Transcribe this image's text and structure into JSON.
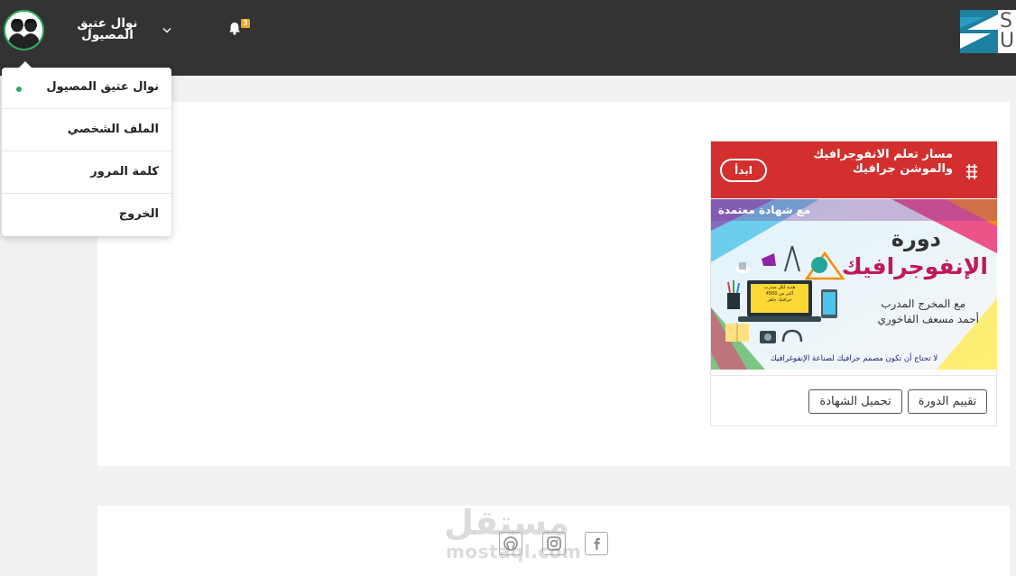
{
  "header": {
    "user_name": "نوال عتيق المصيول",
    "notification_count": "3",
    "brand_letters": [
      "S",
      "U"
    ]
  },
  "user_menu": {
    "items": [
      {
        "label": "نوال عتيق المصيول",
        "online": true
      },
      {
        "label": "الملف الشخصي"
      },
      {
        "label": "كلمة المرور"
      },
      {
        "label": "الخروج"
      }
    ]
  },
  "course": {
    "title": "مسار تعلم الانفوجرافيك والموشن جرافيك",
    "start_label": "ابدأ",
    "banner": {
      "badge": "مع شهادة معتمدة",
      "heading_line1": "دورة",
      "heading_line2": "الإنفوجرافيك",
      "trainer_line1": "مع المخرج المدرب",
      "trainer_line2": "أحمد مسعف الفاخوري",
      "screen_text": [
        "هدية لكل متدرب",
        "أكثر من 4500",
        "جرافيك جاهز"
      ],
      "tagline": "لا تحتاج أن تكون مصمم جرافيك لصناعة الإنفوغرافيك"
    },
    "rate_label": "تقييم الدورة",
    "certificate_label": "تحميل الشهادة"
  },
  "footer": {
    "social_icons": [
      "github-icon",
      "instagram-icon",
      "facebook-icon"
    ],
    "watermark_ar": "مستقل",
    "watermark_en": "mostaql.com"
  },
  "colors": {
    "topbar": "#333333",
    "accent_red": "#d32f2f",
    "online_green": "#27ae60",
    "badge_orange": "#f5a623",
    "banner_magenta": "#c2185b"
  }
}
